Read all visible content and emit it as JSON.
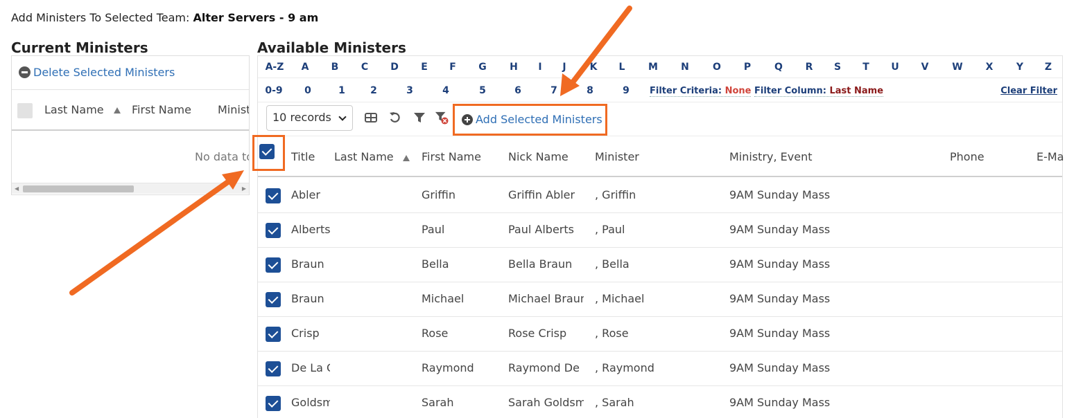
{
  "header": {
    "prefix": "Add Ministers To Selected Team:",
    "team": "Alter Servers - 9 am"
  },
  "current": {
    "title": "Current Ministers",
    "delete_label": "Delete Selected Ministers",
    "columns": [
      "Last Name",
      "First Name",
      "Minist"
    ],
    "no_data": "No data to"
  },
  "available": {
    "title": "Available Ministers",
    "letters": [
      "A-Z",
      "A",
      "B",
      "C",
      "D",
      "E",
      "F",
      "G",
      "H",
      "I",
      "J",
      "K",
      "L",
      "M",
      "N",
      "O",
      "P",
      "Q",
      "R",
      "S",
      "T",
      "U",
      "V",
      "W",
      "X",
      "Y",
      "Z"
    ],
    "numbers": [
      "0-9",
      "0",
      "1",
      "2",
      "3",
      "4",
      "5",
      "6",
      "7",
      "8",
      "9"
    ],
    "filter_criteria_label": "Filter Criteria:",
    "filter_criteria_value": "None",
    "filter_column_label": "Filter Column:",
    "filter_column_value": "Last Name",
    "clear_filter": "Clear Filter",
    "records_select": "10 records",
    "add_label": "Add Selected Ministers",
    "columns": [
      "Title",
      "Last Name",
      "First Name",
      "Nick Name",
      "Minister",
      "Ministry, Event",
      "Phone",
      "E-Ma"
    ],
    "rows": [
      {
        "last": "Abler",
        "first": "Griffin",
        "nick": "Griffin Abler",
        "minister": ", Griffin",
        "event": "9AM Sunday Mass"
      },
      {
        "last": "Alberts",
        "first": "Paul",
        "nick": "Paul Alberts",
        "minister": ", Paul",
        "event": "9AM Sunday Mass"
      },
      {
        "last": "Braun",
        "first": "Bella",
        "nick": "Bella Braun",
        "minister": ", Bella",
        "event": "9AM Sunday Mass"
      },
      {
        "last": "Braun",
        "first": "Michael",
        "nick": "Michael Braun",
        "minister": ", Michael",
        "event": "9AM Sunday Mass"
      },
      {
        "last": "Crisp",
        "first": "Rose",
        "nick": "Rose Crisp",
        "minister": ", Rose",
        "event": "9AM Sunday Mass"
      },
      {
        "last": "De La G",
        "first": "Raymond",
        "nick": "Raymond De La",
        "minister": ", Raymond",
        "event": "9AM Sunday Mass"
      },
      {
        "last": "Goldsm",
        "first": "Sarah",
        "nick": "Sarah Goldsmith",
        "minister": ", Sarah",
        "event": "9AM Sunday Mass"
      }
    ]
  },
  "colors": {
    "accent_orange": "#f06a22",
    "link_blue": "#2f6fb5",
    "letter_navy": "#1d3f7a",
    "checkbox_blue": "#1d4f96"
  }
}
